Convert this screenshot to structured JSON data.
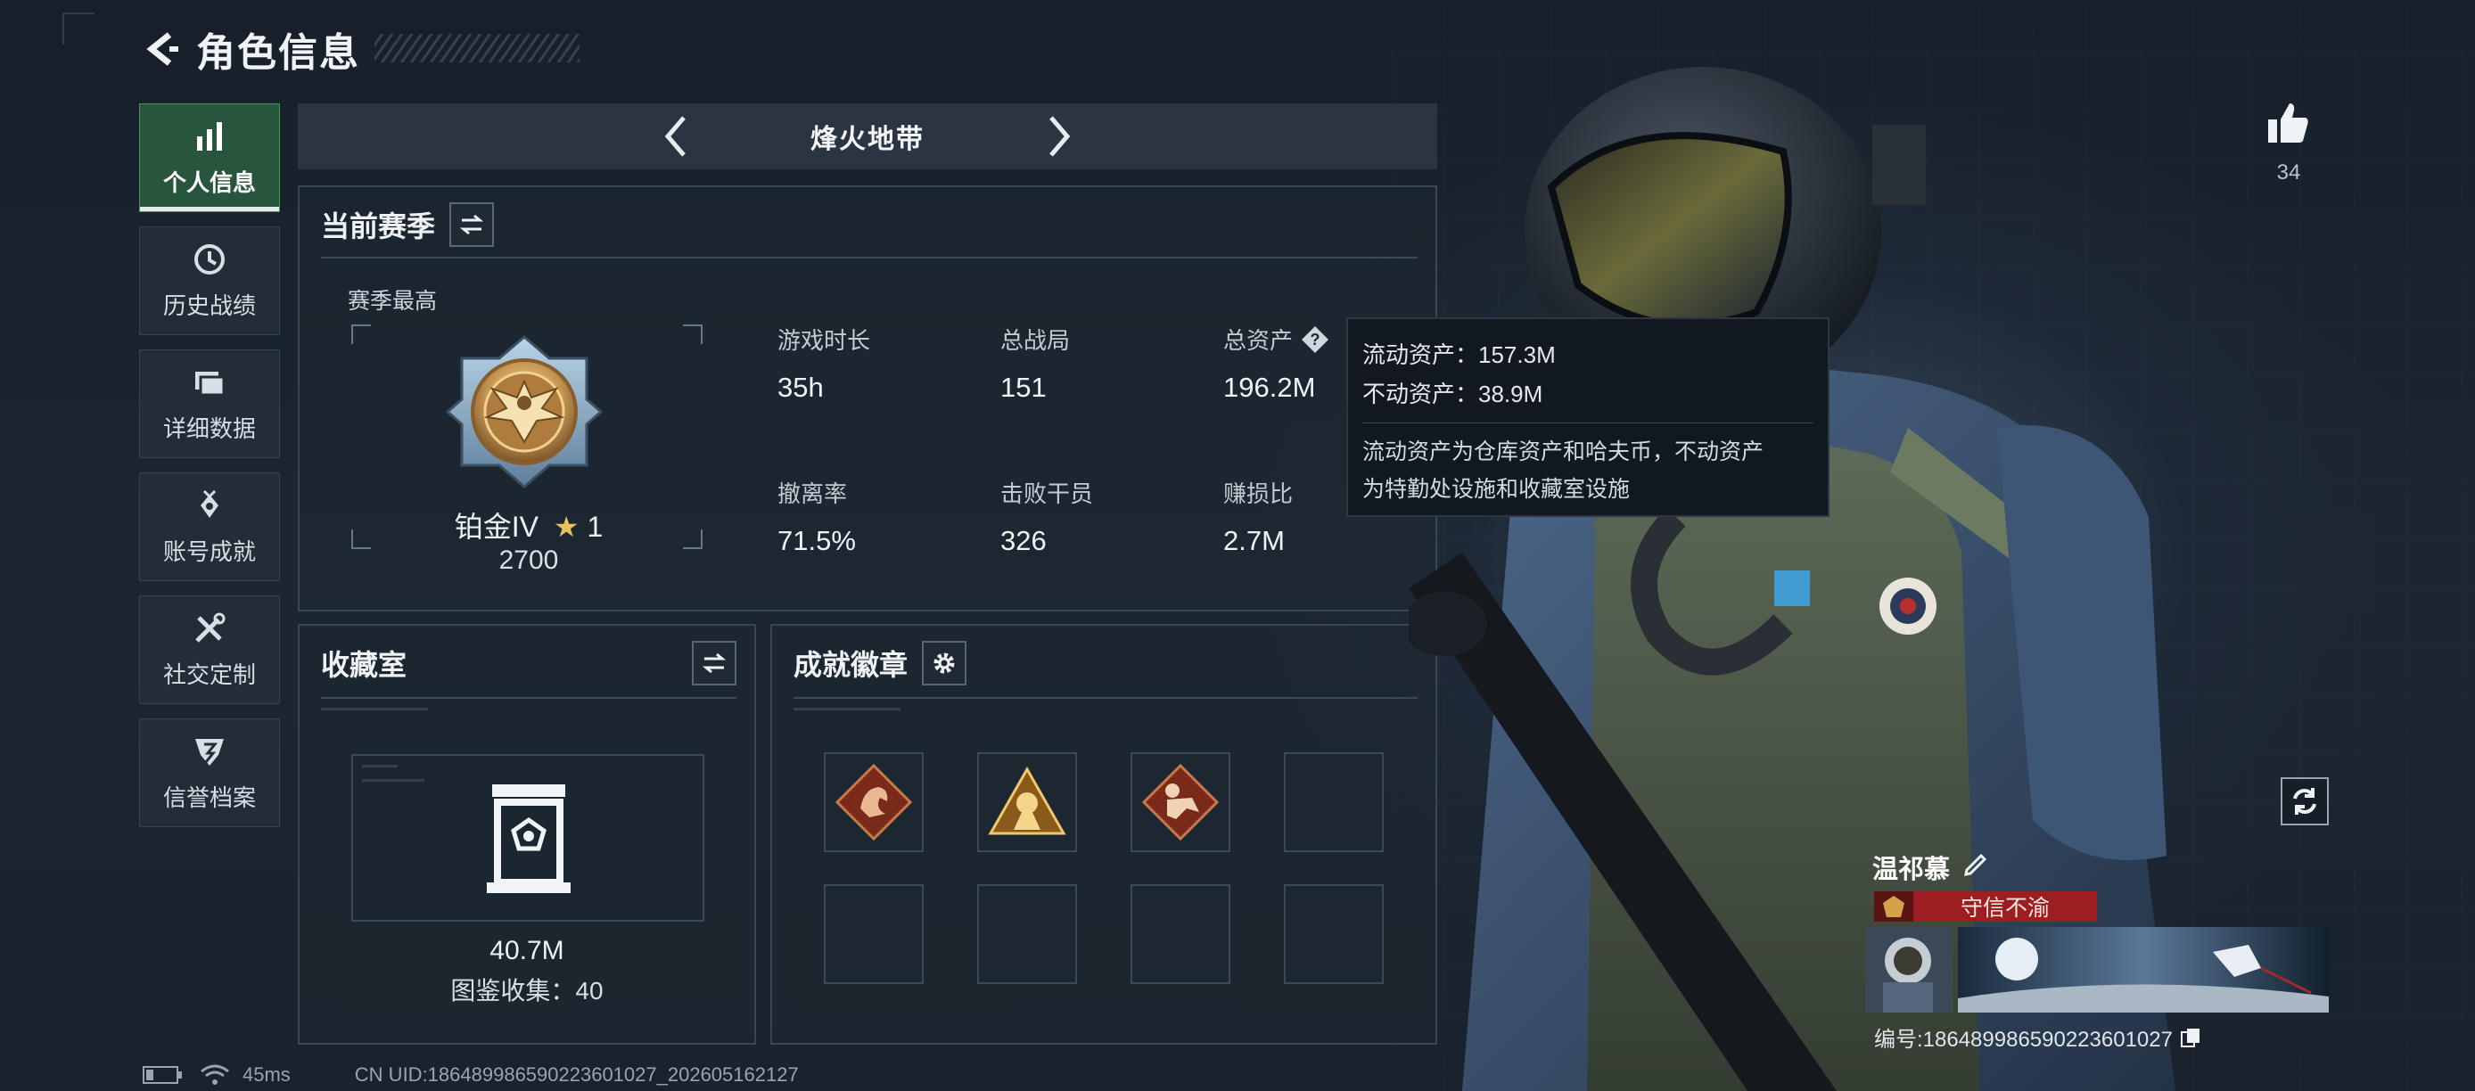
{
  "header": {
    "title": "角色信息"
  },
  "nav": {
    "items": [
      {
        "label": "个人信息",
        "icon": "bar-chart-icon",
        "active": true
      },
      {
        "label": "历史战绩",
        "icon": "history-clock-icon",
        "active": false
      },
      {
        "label": "详细数据",
        "icon": "folder-icon",
        "active": false
      },
      {
        "label": "账号成就",
        "icon": "achievement-icon",
        "active": false
      },
      {
        "label": "社交定制",
        "icon": "tools-icon",
        "active": false
      },
      {
        "label": "信誉档案",
        "icon": "credit-shield-icon",
        "active": false
      }
    ]
  },
  "mode": {
    "name": "烽火地带"
  },
  "season": {
    "title": "当前赛季",
    "subtitle": "赛季最高",
    "rank_name": "铂金IV",
    "rank_stars": "1",
    "rank_score": "2700",
    "stats": [
      {
        "label": "游戏时长",
        "value": "35h"
      },
      {
        "label": "总战局",
        "value": "151"
      },
      {
        "label": "总资产",
        "value": "196.2M"
      },
      {
        "label": "撤离率",
        "value": "71.5%"
      },
      {
        "label": "击败干员",
        "value": "326"
      },
      {
        "label": "赚损比",
        "value": "2.7M"
      }
    ]
  },
  "tooltip": {
    "liquid": "流动资产：157.3M",
    "fixed": "不动资产：38.9M",
    "desc_line1": "流动资产为仓库资产和哈夫币，不动资产",
    "desc_line2": "为特勤处设施和收藏室设施"
  },
  "collection": {
    "title": "收藏室",
    "value": "40.7M",
    "count": "图鉴收集：40"
  },
  "badges": {
    "title": "成就徽章",
    "slots": [
      "dragon-badge-icon",
      "golden-pyramid-badge-icon",
      "crawling-soldier-badge-icon",
      "",
      "",
      "",
      "",
      ""
    ]
  },
  "profile": {
    "likes": "34",
    "name": "温祁慕",
    "honor": "守信不渝",
    "uid": "编号:18648998659022360102​7"
  },
  "status": {
    "ping": "45ms",
    "uid": "CN UID:18648998659022360102​7_202605162127"
  },
  "colors": {
    "accent_green": "#28563c",
    "honor_red": "#9d1e22",
    "background": "#1c2631"
  }
}
